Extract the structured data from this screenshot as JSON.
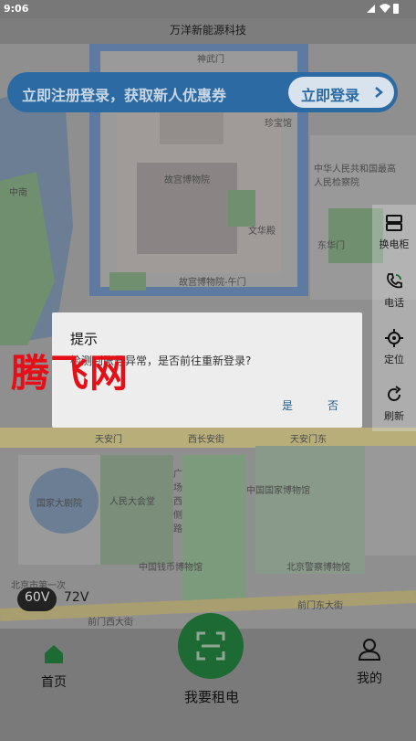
{
  "status_bar": {
    "time": "9:06"
  },
  "app": {
    "title": "万洋新能源科技"
  },
  "map": {
    "labels": {
      "shenwumen": "神武门",
      "zhenbao": "珍宝馆",
      "gugong": "故宫博物院",
      "wenhua": "文华殿",
      "meridian": "故宫博物院-午门",
      "donghuamen": "东华门",
      "zhongnanhai": "中南",
      "renmin_gonghe": "中华人民共和国最高人民检察院",
      "tiananmen": "天安门",
      "xichang": "西长安街",
      "dongan": "天安门东",
      "guojia_daju": "国家大剧院",
      "renmin_dahuitang": "人民大会堂",
      "guangchang": "广场西侧路",
      "guojia_bowuguan": "中国国家博物馆",
      "qianbi": "中国钱币博物馆",
      "jingcha": "北京警察博物馆",
      "qianmen_west": "前门西大街",
      "qianmen_east": "前门东大街",
      "beijing_shi": "北京市第一次"
    }
  },
  "promo": {
    "text": "立即注册登录，获取新人优惠券",
    "button": "立即登录"
  },
  "tools": [
    {
      "label": "换电柜",
      "icon": "cabinet-icon"
    },
    {
      "label": "电话",
      "icon": "phone-icon"
    },
    {
      "label": "定位",
      "icon": "locate-icon"
    },
    {
      "label": "刷新",
      "icon": "refresh-icon"
    }
  ],
  "voltage": {
    "options": [
      "60V",
      "72V"
    ],
    "selected": "60V"
  },
  "nav": {
    "home": "首页",
    "scan": "我要租电",
    "mine": "我的"
  },
  "dialog": {
    "title": "提示",
    "message": "检测到账号异常，是否前往重新登录?",
    "yes": "是",
    "no": "否"
  },
  "watermark": "腾飞网",
  "colors": {
    "accent": "#2b6aa3",
    "primary_green": "#1e6a34",
    "watermark": "#e50f17"
  }
}
